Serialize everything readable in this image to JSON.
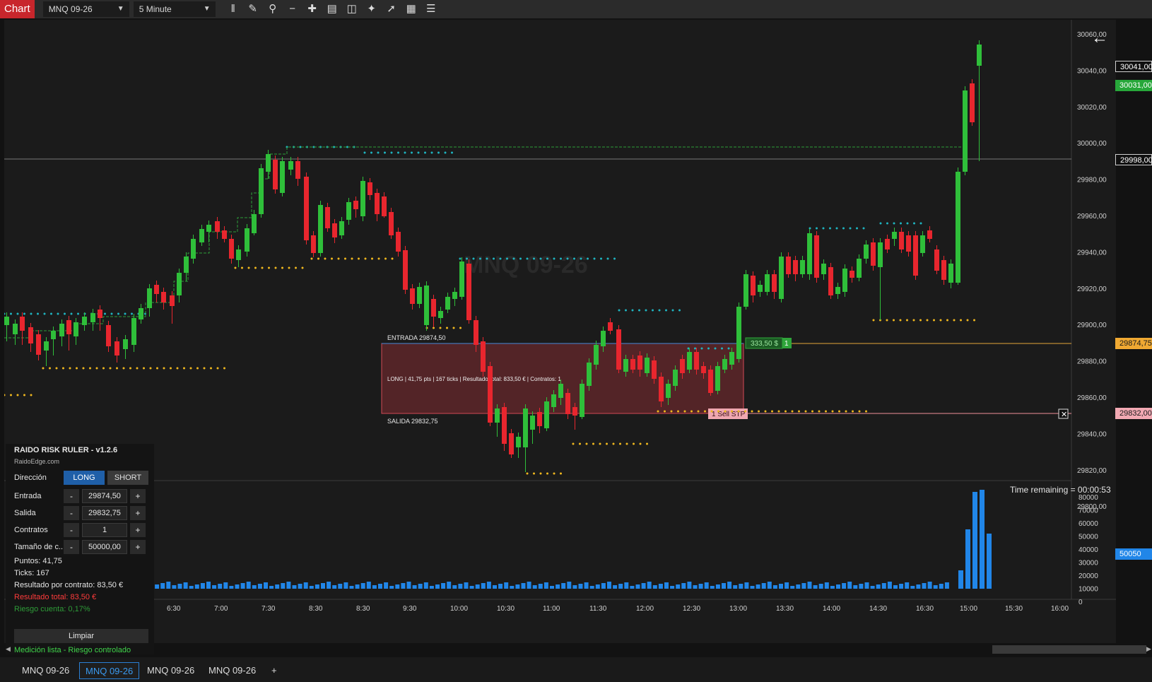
{
  "toolbar": {
    "app_tab": "Chart",
    "instrument": "MNQ 09-26",
    "timeframe": "5 Minute",
    "tools": [
      "bar-type-icon",
      "draw-icon",
      "zoom-in-icon",
      "zoom-out-icon",
      "crosshair-icon",
      "snapshot-icon",
      "data-box-icon",
      "indicators-icon",
      "strategies-icon",
      "properties-icon",
      "templates-icon"
    ]
  },
  "watermark": "MNQ 09-26",
  "price_axis": {
    "ticks": [
      "30060,00",
      "30040,00",
      "30020,00",
      "30000,00",
      "29980,00",
      "29960,00",
      "29940,00",
      "29920,00",
      "29900,00",
      "29880,00",
      "29860,00",
      "29840,00",
      "29820,00",
      "29800,00"
    ],
    "markers": [
      {
        "label": "30041,00",
        "style": "dark"
      },
      {
        "label": "30031,00",
        "style": "green"
      },
      {
        "label": "29998,00",
        "style": "dark"
      },
      {
        "label": "29874,75",
        "style": "orange"
      },
      {
        "label": "29832,00",
        "style": "pink"
      }
    ]
  },
  "volume_axis": {
    "ticks": [
      "80000",
      "70000",
      "60000",
      "50000",
      "40000",
      "30000",
      "20000",
      "10000",
      "0"
    ],
    "marker": "50050"
  },
  "time_axis": [
    "6:30",
    "7:00",
    "7:30",
    "8:30",
    "8:30",
    "9:30",
    "10:00",
    "10:30",
    "11:00",
    "11:30",
    "12:00",
    "12:30",
    "13:00",
    "13:30",
    "14:00",
    "14:30",
    "16:30",
    "15:00",
    "15:30",
    "16:00"
  ],
  "overlay": {
    "entrada_label": "ENTRADA  29874,50",
    "salida_label": "SALIDA  29832,75",
    "summary": "LONG | 41,75 pts | 167 ticks | Resultado total: 833,50 € | Contratos: 1",
    "pnl_badge": "333,50 $",
    "pnl_qty": "1",
    "sell_stop": "1 Sell STP",
    "time_remaining": "Time remaining = 00:00:53"
  },
  "panel": {
    "title": "RAIDO RISK RULER - v1.2.6",
    "site": "RaidoEdge.com",
    "direction_label": "Dirección",
    "long": "LONG",
    "short": "SHORT",
    "entrada_label": "Entrada",
    "entrada_value": "29874,50",
    "salida_label": "Salida",
    "salida_value": "29832,75",
    "contratos_label": "Contratos",
    "contratos_value": "1",
    "tamano_label": "Tamaño de c...",
    "tamano_value": "50000,00",
    "minus": "-",
    "plus": "+",
    "puntos": "Puntos: 41,75",
    "ticks": "Ticks: 167",
    "resultado_contrato": "Resultado por contrato: 83,50 €",
    "resultado_total": "Resultado total: 83,50 €",
    "riesgo": "Riesgo cuenta: 0,17%",
    "limpiar": "Limpiar",
    "status": "Medición lista - Riesgo controlado"
  },
  "tabs": [
    "MNQ 09-26",
    "MNQ 09-26",
    "MNQ 09-26",
    "MNQ 09-26",
    "+"
  ],
  "colors": {
    "up": "#2fbf3a",
    "down": "#e8262e",
    "volume": "#2186e8",
    "accent": "#2a7fd4"
  }
}
